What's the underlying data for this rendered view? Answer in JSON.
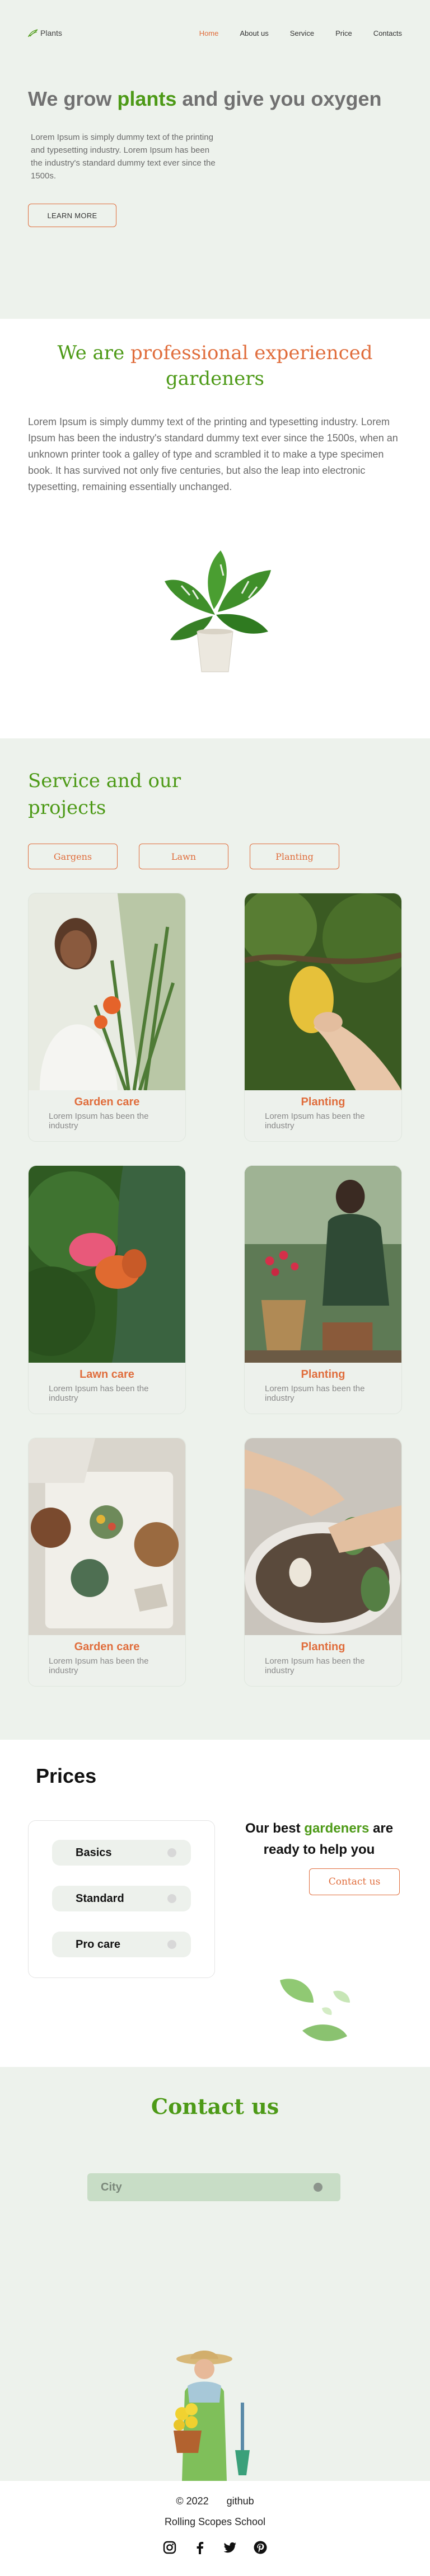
{
  "header": {
    "logo_text": "Plants",
    "nav": [
      "Home",
      "About us",
      "Service",
      "Price",
      "Contacts"
    ]
  },
  "hero": {
    "title_pre": "We grow ",
    "title_accent": "plants",
    "title_post": " and give you oxygen",
    "text": "Lorem Ipsum is simply dummy text of the printing and typesetting industry. Lorem Ipsum has been the industry's standard dummy text ever since the 1500s.",
    "button": "LEARN MORE"
  },
  "about": {
    "title_a": "We are ",
    "title_b": "professional experienced",
    "title_c": " gardeners",
    "text": "Lorem Ipsum is simply dummy text of the printing and typesetting industry. Lorem Ipsum has been the industry's standard dummy text ever since the 1500s, when an unknown printer took a galley of type and scrambled it to make a type specimen book. It has survived not only five centuries, but also the leap into electronic typesetting, remaining essentially unchanged."
  },
  "service": {
    "title": "Service and our projects",
    "filters": [
      "Gargens",
      "Lawn",
      "Planting"
    ],
    "cards": [
      {
        "title": "Garden care",
        "text": "Lorem Ipsum has been the industry"
      },
      {
        "title": "Planting",
        "text": "Lorem Ipsum has been the industry"
      },
      {
        "title": "Lawn care",
        "text": "Lorem Ipsum has been the industry"
      },
      {
        "title": "Planting",
        "text": "Lorem Ipsum has been the industry"
      },
      {
        "title": "Garden care",
        "text": "Lorem Ipsum has been the industry"
      },
      {
        "title": "Planting",
        "text": "Lorem Ipsum has been the industry"
      }
    ]
  },
  "prices": {
    "title": "Prices",
    "plans": [
      "Basics",
      "Standard",
      "Pro care"
    ],
    "offer_pre": "Our best ",
    "offer_accent": "gardeners",
    "offer_post": " are ready to help you",
    "button": "Contact us"
  },
  "contact": {
    "title": "Contact us",
    "city": "City"
  },
  "footer": {
    "copyright": "© 2022",
    "github": "github",
    "school": "Rolling Scopes School",
    "socials": [
      "instagram-icon",
      "facebook-icon",
      "twitter-icon",
      "pinterest-icon"
    ]
  },
  "colors": {
    "green": "#4d9a17",
    "orange": "#e06d3c",
    "bg": "#edf2ec"
  }
}
